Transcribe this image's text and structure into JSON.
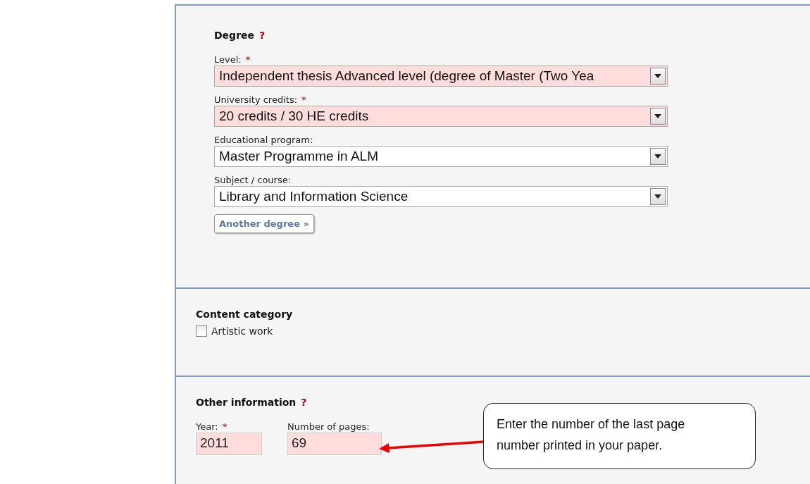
{
  "degree": {
    "title": "Degree",
    "help": "?",
    "fields": [
      {
        "label": "Level:",
        "mark": "*",
        "highlighted": true,
        "value": "Independent thesis Advanced level (degree of Master (Two Yea"
      },
      {
        "label": "University credits:",
        "mark": "*",
        "highlighted": true,
        "value": "20 credits / 30 HE credits"
      },
      {
        "label": "Educational program:",
        "highlighted": false,
        "value": "Master Programme in ALM"
      },
      {
        "label": "Subject / course:",
        "highlighted": false,
        "value": "Library and Information Science"
      }
    ],
    "button": "Another degree »"
  },
  "content_category": {
    "title": "Content category",
    "options": [
      {
        "label": "Artistic work",
        "checked": false
      }
    ]
  },
  "other_information": {
    "title": "Other information",
    "help": "?",
    "fields": [
      {
        "label": "Year:",
        "mark": "*",
        "highlighted": true,
        "value": "2011"
      },
      {
        "label": "Number of pages:",
        "highlighted": true,
        "value": "69"
      }
    ]
  },
  "callout": {
    "text": "Enter the number of the last page number printed in your paper."
  }
}
